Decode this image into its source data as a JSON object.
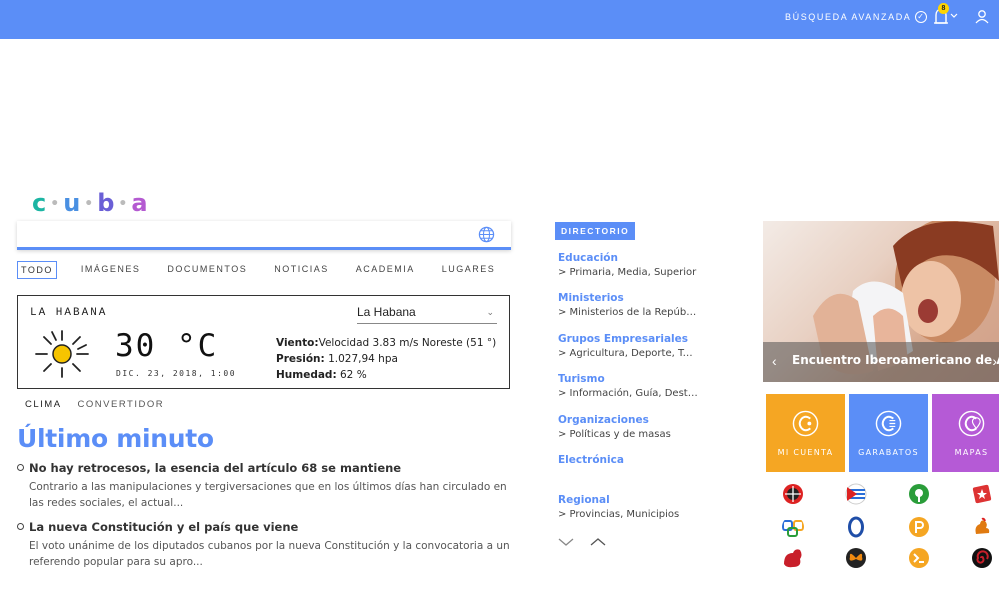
{
  "header": {
    "advanced_search": "BÚSQUEDA AVANZADA",
    "notification_count": "8",
    "brand_color": "#5b8ef7"
  },
  "logo": {
    "letters": [
      "c",
      "u",
      "b",
      "a"
    ],
    "colors": [
      "#1cb5a3",
      "#4a90e2",
      "#6a5fd6",
      "#b45ad1"
    ]
  },
  "search": {
    "value": "",
    "placeholder": ""
  },
  "tabs": [
    "TODO",
    "IMÁGENES",
    "DOCUMENTOS",
    "NOTICIAS",
    "ACADEMIA",
    "LUGARES"
  ],
  "weather": {
    "city": "LA HABANA",
    "selected_city": "La Habana",
    "temperature": "30 °C",
    "date": "DIC. 23, 2018, 1:00",
    "wind_label": "Viento:",
    "wind_value": "Velocidad 3.83 m/s Noreste (51 °)",
    "pressure_label": "Presión:",
    "pressure_value": "1.027,94 hpa",
    "humidity_label": "Humedad:",
    "humidity_value": "62 %"
  },
  "subtabs": [
    "CLIMA",
    "CONVERTIDOR"
  ],
  "latest": {
    "heading": "Último minuto",
    "items": [
      {
        "title": "No hay retrocesos, la esencia del artículo 68 se mantiene",
        "desc": "Contrario a las manipulaciones y tergiversaciones que en los últimos días han circulado en las redes sociales, el actual..."
      },
      {
        "title": "La nueva Constitución y el país que viene",
        "desc": "El voto unánime de los diputados cubanos por la nueva Constitución y la convocatoria a un referendo popular para su apro..."
      }
    ]
  },
  "directory": {
    "header": "DIRECTORIO",
    "categories": [
      {
        "title": "Educación",
        "sub": "> Primaria, Media, Superior"
      },
      {
        "title": "Ministerios",
        "sub": "> Ministerios de la Repúbli..."
      },
      {
        "title": "Grupos Empresariales",
        "sub": "> Agricultura, Deporte, Tur..."
      },
      {
        "title": "Turismo",
        "sub": "> Información, Guía, Destin..."
      },
      {
        "title": "Organizaciones",
        "sub": "> Políticas y de masas"
      },
      {
        "title": "Electrónica",
        "sub": ""
      },
      {
        "title": "Regional",
        "sub": "> Provincias, Municipios"
      }
    ]
  },
  "hero": {
    "caption": "Encuentro Iberoamericano de Al..."
  },
  "tiles": [
    {
      "label": "MI CUENTA",
      "color": "#f5a623"
    },
    {
      "label": "GARABATOS",
      "color": "#5b8ef7"
    },
    {
      "label": "MAPAS",
      "color": "#b55ad6"
    }
  ],
  "apps": [
    {
      "name": "compass-app-icon",
      "color": "#d22"
    },
    {
      "name": "flag-app-icon",
      "color": "#c33"
    },
    {
      "name": "tree-app-icon",
      "color": "#2a9d3a"
    },
    {
      "name": "star-app-icon",
      "color": "#d33"
    },
    {
      "name": "link-app-icon",
      "color": "#2a6ed8"
    },
    {
      "name": "zero-app-icon",
      "color": "#1f4ea8"
    },
    {
      "name": "p-app-icon",
      "color": "#f5a623"
    },
    {
      "name": "rooster-app-icon",
      "color": "#e07a10"
    },
    {
      "name": "shape-app-icon",
      "color": "#c81f2a"
    },
    {
      "name": "butterfly-app-icon",
      "color": "#f08a10"
    },
    {
      "name": "terminal-app-icon",
      "color": "#f5a623"
    },
    {
      "name": "spiral-app-icon",
      "color": "#c81f2a"
    }
  ]
}
